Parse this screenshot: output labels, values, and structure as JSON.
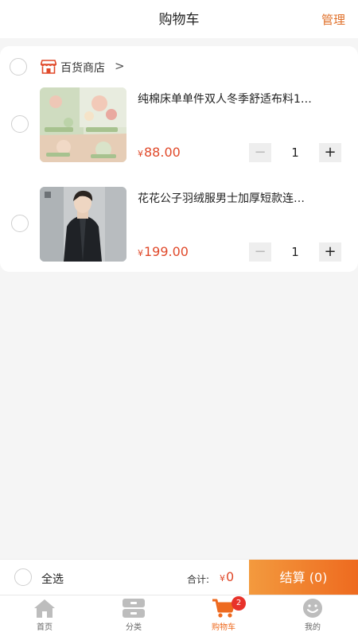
{
  "header": {
    "title": "购物车",
    "manage_label": "管理"
  },
  "store": {
    "name": "百货商店",
    "chevron": ">"
  },
  "items": [
    {
      "title": "纯棉床单单件双人冬季舒适布料1…",
      "currency": "¥",
      "price": "88.00",
      "quantity": "1",
      "image": "floral-bedsheet"
    },
    {
      "title": "花花公子羽绒服男士加厚短款连…",
      "currency": "¥",
      "price": "199.00",
      "quantity": "1",
      "image": "man-black-down-jacket"
    }
  ],
  "checkout": {
    "select_all_label": "全选",
    "total_label": "合计:",
    "total_currency": "¥",
    "total_value": "0",
    "button_label": "结算 (0)"
  },
  "tabbar": {
    "items": [
      {
        "label": "首页",
        "icon": "home-icon"
      },
      {
        "label": "分类",
        "icon": "category-icon"
      },
      {
        "label": "购物车",
        "icon": "cart-icon",
        "badge": "2",
        "active": true
      },
      {
        "label": "我的",
        "icon": "profile-icon"
      }
    ]
  },
  "colors": {
    "accent": "#ee6a1f",
    "price": "#e0492a",
    "badge": "#e8322a"
  }
}
